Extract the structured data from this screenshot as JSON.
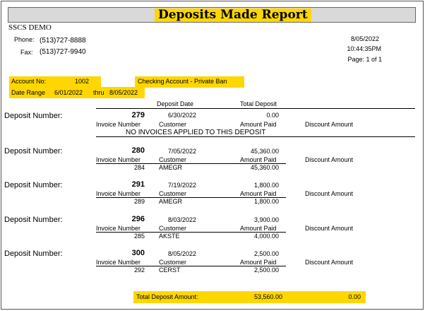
{
  "report": {
    "title": "Deposits Made Report"
  },
  "company": {
    "name": "SSCS DEMO",
    "phone_label": "Phone:",
    "phone": "(513)727-8888",
    "fax_label": "Fax:",
    "fax": "(513)727-9940"
  },
  "meta": {
    "date": "8/05/2022",
    "time": "10:44:35PM",
    "page": "Page: 1 of 1"
  },
  "account": {
    "label": "Account No:",
    "number": "1002",
    "name": "Checking Account - Private Ban",
    "date_range_label": "Date Range",
    "date_from": "6/01/2022",
    "thru": "thru",
    "date_to": "8/05/2022"
  },
  "columns": {
    "deposit_date": "Deposit Date",
    "total_deposit": "Total Deposit"
  },
  "labels": {
    "deposit_number": "Deposit Number:",
    "invoice_number": "Invoice Number",
    "customer": "Customer",
    "amount_paid": "Amount Paid",
    "discount_amount": "Discount Amount",
    "no_invoices": "NO INVOICES APPLIED TO THIS DEPOSIT"
  },
  "deposits": [
    {
      "number": "279",
      "date": "6/30/2022",
      "total": "0.00",
      "invoice": "",
      "customer": "",
      "amount_paid": ""
    },
    {
      "number": "280",
      "date": "7/05/2022",
      "total": "45,360.00",
      "invoice": "284",
      "customer": "AMEGR",
      "amount_paid": "45,360.00"
    },
    {
      "number": "291",
      "date": "7/19/2022",
      "total": "1,800.00",
      "invoice": "289",
      "customer": "AMEGR",
      "amount_paid": "1,800.00"
    },
    {
      "number": "296",
      "date": "8/03/2022",
      "total": "3,900.00",
      "invoice": "285",
      "customer": "AKSTE",
      "amount_paid": "4,000.00"
    },
    {
      "number": "300",
      "date": "8/05/2022",
      "total": "2,500.00",
      "invoice": "292",
      "customer": "CERST",
      "amount_paid": "2,500.00"
    }
  ],
  "totals": {
    "label": "Total Deposit Amount:",
    "amount": "53,560.00",
    "discount": "0.00"
  },
  "colors": {
    "highlight": "#ffd700",
    "title_band": "#d9d9d9"
  }
}
